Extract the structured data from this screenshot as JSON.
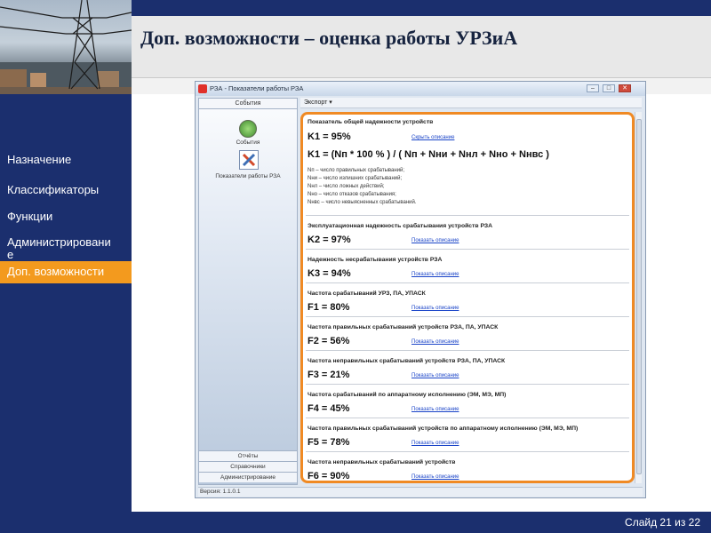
{
  "slide": {
    "title": "Доп. возможности – оценка работы УРЗиА",
    "slide_number": "Слайд 21 из 22"
  },
  "nav": {
    "items": [
      "Назначение",
      "Классификаторы",
      "Функции",
      "Администрировани\nе"
    ],
    "active": "Доп. возможности"
  },
  "app": {
    "title": "РЗА - Показатели работы РЗА",
    "window_buttons": [
      "–",
      "□",
      "✕"
    ],
    "sidebar": {
      "top_tab": "События",
      "items": [
        {
          "label": "События",
          "icon": "events-icon"
        },
        {
          "label": "Показатели работы РЗА",
          "icon": "tools-icon"
        }
      ],
      "bottom_tabs": [
        "Отчёты",
        "Справочники",
        "Администрирование"
      ]
    },
    "toolbar": {
      "export_label": "Экспорт ▾"
    },
    "version": "Версия: 1.1.0.1",
    "blocks": [
      {
        "title": "Показатель общей надежности устройств",
        "value": "K1 = 95%",
        "link": "Скрыть описание",
        "formula": "K1 = (Nп  * 100 % ) / ( Nп + Nни + Nнл + Nно + Nнвс )",
        "legend": [
          "Nп – число правильных срабатываний;",
          "Nни – число излишних срабатываний;",
          "Nнл – число ложных действий;",
          "Nно – число отказов срабатывания;",
          "Nнвс – число невыясненных срабатываний."
        ]
      },
      {
        "title": "Эксплуатационная надежность срабатывания устройств РЗА",
        "value": "K2 = 97%",
        "link": "Показать описание"
      },
      {
        "title": "Надежность несрабатывания устройств РЗА",
        "value": "K3 = 94%",
        "link": "Показать описание"
      },
      {
        "title": "Частота срабатываний УРЗ, ПА, УПАСК",
        "value": "F1 = 80%",
        "link": "Показать описание"
      },
      {
        "title": "Частота правильных срабатываний устройств РЗА, ПА, УПАСК",
        "value": "F2 = 56%",
        "link": "Показать описание"
      },
      {
        "title": "Частота неправильных срабатываний устройств РЗА, ПА, УПАСК",
        "value": "F3 = 21%",
        "link": "Показать описание"
      },
      {
        "title": "Частота срабатываний по аппаратному исполнению (ЭМ, МЭ, МП)",
        "value": "F4 = 45%",
        "link": "Показать описание"
      },
      {
        "title": "Частота правильных срабатываний устройств по аппаратному исполнению (ЭМ, МЭ, МП)",
        "value": "F5 = 78%",
        "link": "Показать описание"
      },
      {
        "title": "Частота неправильных срабатываний устройств",
        "value": "F6 = 90%",
        "link": "Показать описание"
      }
    ]
  },
  "colors": {
    "brand_navy": "#1b2f6e",
    "accent_orange": "#f39a1e",
    "link_blue": "#1a44c8"
  }
}
